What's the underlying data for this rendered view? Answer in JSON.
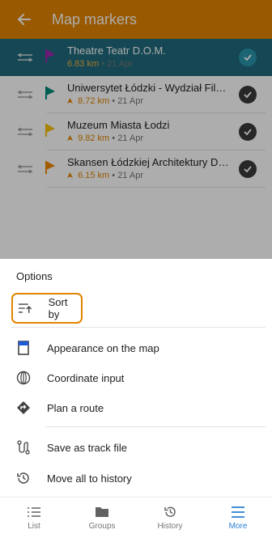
{
  "appbar": {
    "title": "Map markers"
  },
  "markers": [
    {
      "name": "Theatre Teatr D.O.M.",
      "distance": "6.83 km",
      "date": "21 Apr",
      "flag_color": "#9c27b0",
      "selected": true
    },
    {
      "name": "Uniwersytet Łódzki - Wydział Filolo...",
      "distance": "8.72 km",
      "date": "21 Apr",
      "flag_color": "#00897b",
      "selected": false
    },
    {
      "name": "Muzeum Miasta Łodzi",
      "distance": "9.82 km",
      "date": "21 Apr",
      "flag_color": "#f9c20a",
      "selected": false
    },
    {
      "name": "Skansen Łódzkiej Architektury Dre...",
      "distance": "6.15 km",
      "date": "21 Apr",
      "flag_color": "#f08a00",
      "selected": false
    }
  ],
  "options": {
    "heading": "Options",
    "items": [
      {
        "label": "Sort by",
        "icon": "sort-icon"
      },
      {
        "label": "Appearance on the map",
        "icon": "appearance-icon"
      },
      {
        "label": "Coordinate input",
        "icon": "coordinate-icon"
      },
      {
        "label": "Plan a route",
        "icon": "route-icon"
      },
      {
        "label": "Save as track file",
        "icon": "track-file-icon"
      },
      {
        "label": "Move all to history",
        "icon": "history-icon"
      }
    ]
  },
  "bottom_nav": [
    {
      "label": "List",
      "icon": "list-icon",
      "active": false
    },
    {
      "label": "Groups",
      "icon": "folder-icon",
      "active": false
    },
    {
      "label": "History",
      "icon": "history-icon",
      "active": false
    },
    {
      "label": "More",
      "icon": "menu-icon",
      "active": true
    }
  ],
  "colors": {
    "accent": "#e28400",
    "selected_row": "#1f6a7c",
    "active_tab": "#2a7fd3"
  }
}
